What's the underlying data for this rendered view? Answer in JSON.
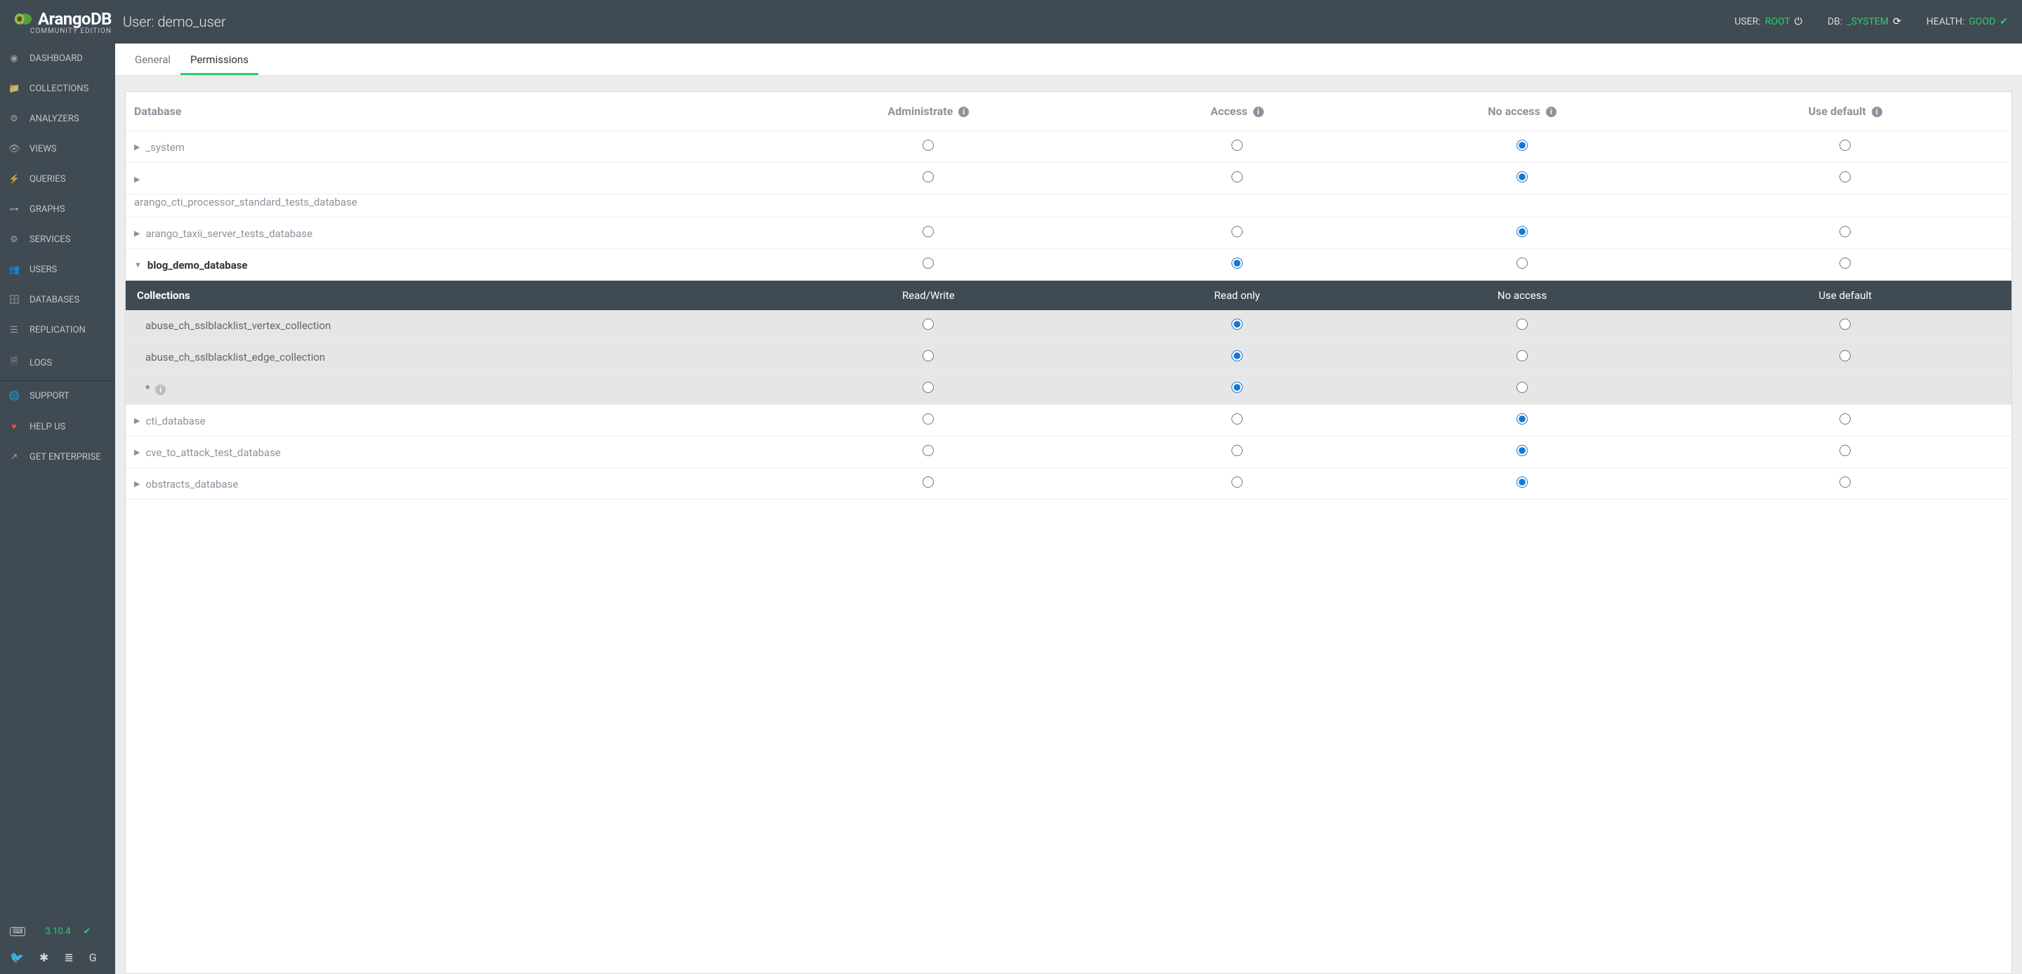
{
  "header": {
    "brand": "ArangoDB",
    "edition": "COMMUNITY EDITION",
    "page_title": "User: demo_user",
    "user_label": "USER:",
    "user_value": "ROOT",
    "db_label": "DB:",
    "db_value": "_SYSTEM",
    "health_label": "HEALTH:",
    "health_value": "GOOD"
  },
  "sidebar": {
    "items": [
      {
        "label": "DASHBOARD",
        "icon": "dashboard"
      },
      {
        "label": "COLLECTIONS",
        "icon": "folder"
      },
      {
        "label": "ANALYZERS",
        "icon": "gear"
      },
      {
        "label": "VIEWS",
        "icon": "eye"
      },
      {
        "label": "QUERIES",
        "icon": "bolt"
      },
      {
        "label": "GRAPHS",
        "icon": "graph"
      },
      {
        "label": "SERVICES",
        "icon": "gears"
      },
      {
        "label": "USERS",
        "icon": "users"
      },
      {
        "label": "DATABASES",
        "icon": "database"
      },
      {
        "label": "REPLICATION",
        "icon": "replication"
      },
      {
        "label": "LOGS",
        "icon": "file"
      }
    ],
    "support": "SUPPORT",
    "helpus": "HELP US",
    "enterprise": "GET ENTERPRISE",
    "version": "3.10.4"
  },
  "tabs": {
    "general": "General",
    "permissions": "Permissions"
  },
  "table": {
    "headers": {
      "database": "Database",
      "administrate": "Administrate",
      "access": "Access",
      "noaccess": "No access",
      "usedefault": "Use default"
    },
    "sub_headers": {
      "collections": "Collections",
      "readwrite": "Read/Write",
      "readonly": "Read only",
      "noaccess": "No access",
      "usedefault": "Use default"
    },
    "rows": [
      {
        "name": "_system",
        "expanded": false,
        "selected": 2
      },
      {
        "name": "arango_cti_processor_standard_tests_database",
        "expanded": false,
        "selected": 2,
        "wrapped": true
      },
      {
        "name": "arango_taxii_server_tests_database",
        "expanded": false,
        "selected": 2
      },
      {
        "name": "blog_demo_database",
        "expanded": true,
        "selected": 1,
        "subrows": [
          {
            "name": "abuse_ch_sslblacklist_vertex_collection",
            "selected": 1
          },
          {
            "name": "abuse_ch_sslblacklist_edge_collection",
            "selected": 1
          },
          {
            "name": "*",
            "info": true,
            "selected": 1,
            "hide_default": true
          }
        ]
      },
      {
        "name": "cti_database",
        "expanded": false,
        "selected": 2
      },
      {
        "name": "cve_to_attack_test_database",
        "expanded": false,
        "selected": 2
      },
      {
        "name": "obstracts_database",
        "expanded": false,
        "selected": 2
      }
    ]
  }
}
